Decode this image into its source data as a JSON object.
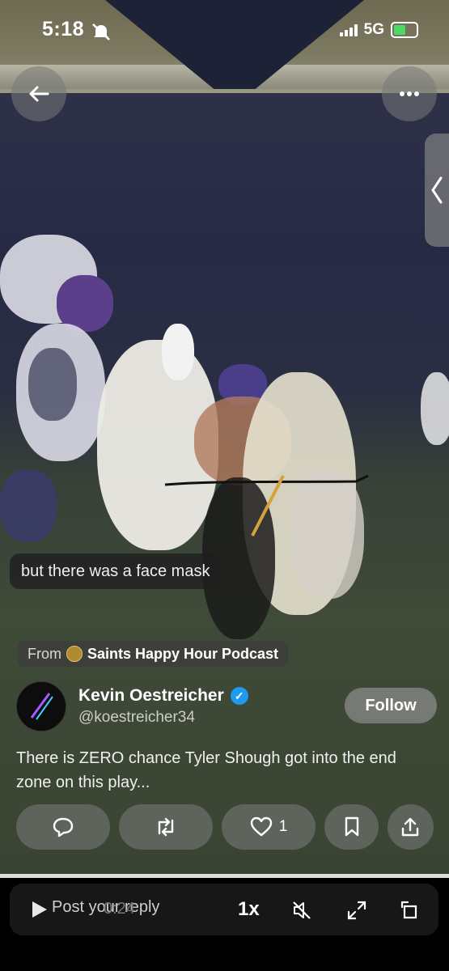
{
  "status_bar": {
    "time": "5:18",
    "network": "5G",
    "battery": "54"
  },
  "caption": "but there was a face mask",
  "source": {
    "prefix": "From",
    "name": "Saints Happy Hour Podcast"
  },
  "author": {
    "name": "Kevin Oestreicher",
    "handle": "@koestreicher34"
  },
  "follow_label": "Follow",
  "post_text": "There is ZERO chance Tyler Shough got into the end zone on this play...",
  "actions": {
    "like_count": "1"
  },
  "player": {
    "reply_placeholder": "Post your reply",
    "timecode": "0:24",
    "speed": "1x"
  },
  "icons": [
    "back-arrow-icon",
    "more-icon",
    "collapse-chevron-icon",
    "reply-icon",
    "repost-icon",
    "heart-icon",
    "bookmark-icon",
    "share-icon",
    "play-icon",
    "mute-icon",
    "fullscreen-icon",
    "rotate-icon",
    "verified-icon",
    "bell-off-icon"
  ],
  "colors": {
    "verified": "#1d9bf0",
    "battery_fill": "#4cd964"
  }
}
